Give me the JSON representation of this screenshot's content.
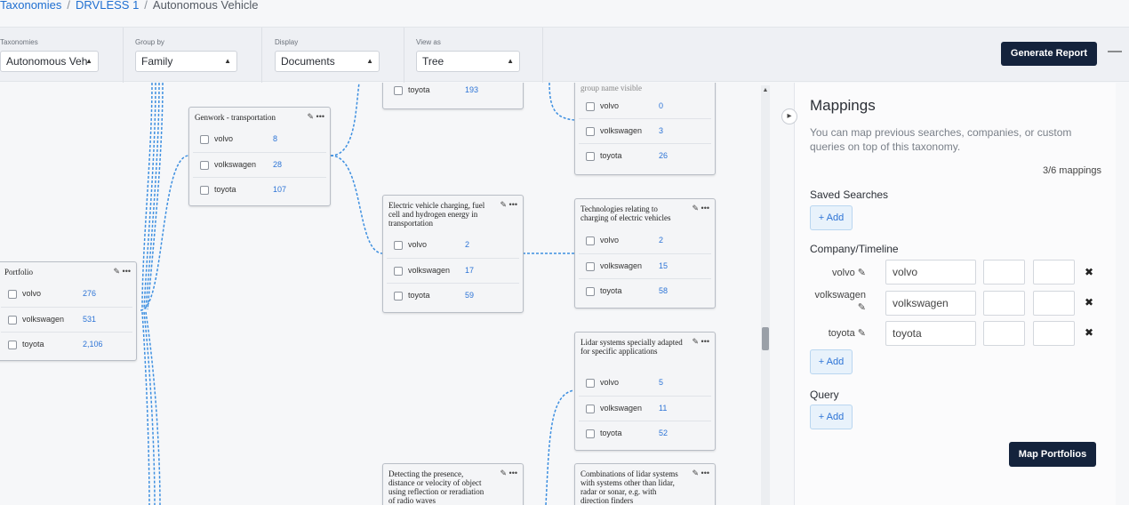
{
  "breadcrumb": {
    "items": [
      "Taxonomies",
      "DRVLESS 1",
      "Autonomous Vehicle"
    ],
    "separator": "/"
  },
  "toolbar": {
    "groups": [
      {
        "label": "Taxonomies",
        "value": "Autonomous Veh"
      },
      {
        "label": "Group by",
        "value": "Family"
      },
      {
        "label": "Display",
        "value": "Documents"
      },
      {
        "label": "View as",
        "value": "Tree"
      }
    ],
    "generate_report": "Generate Report",
    "more_icon": "more-horizontal-icon"
  },
  "tree": {
    "nodes": [
      {
        "id": "portfolio",
        "title": "Portfolio",
        "rows": [
          {
            "label": "volvo",
            "count": "276"
          },
          {
            "label": "volkswagen",
            "count": "531"
          },
          {
            "label": "toyota",
            "count": "2,106"
          }
        ]
      },
      {
        "id": "genwork",
        "title": "Genwork - transportation",
        "rows": [
          {
            "label": "volvo",
            "count": "8"
          },
          {
            "label": "volkswagen",
            "count": "28"
          },
          {
            "label": "toyota",
            "count": "107"
          }
        ]
      },
      {
        "id": "top-mid",
        "title": "",
        "rows": [
          {
            "label": "toyota",
            "count": "193"
          }
        ]
      },
      {
        "id": "ev",
        "title": "Electric vehicle charging, fuel cell and hydrogen energy in transportation",
        "rows": [
          {
            "label": "volvo",
            "count": "2"
          },
          {
            "label": "volkswagen",
            "count": "17"
          },
          {
            "label": "toyota",
            "count": "59"
          }
        ]
      },
      {
        "id": "top-right",
        "title": "group name visible",
        "rows": [
          {
            "label": "volvo",
            "count": "0"
          },
          {
            "label": "volkswagen",
            "count": "3"
          },
          {
            "label": "toyota",
            "count": "26"
          }
        ]
      },
      {
        "id": "tech",
        "title": "Technologies relating to charging of electric vehicles",
        "rows": [
          {
            "label": "volvo",
            "count": "2"
          },
          {
            "label": "volkswagen",
            "count": "15"
          },
          {
            "label": "toyota",
            "count": "58"
          }
        ]
      },
      {
        "id": "lidar",
        "title": "Lidar systems specially adapted for specific applications",
        "rows": [
          {
            "label": "volvo",
            "count": "5"
          },
          {
            "label": "volkswagen",
            "count": "11"
          },
          {
            "label": "toyota",
            "count": "52"
          }
        ]
      },
      {
        "id": "detect",
        "title": "Detecting the presence, distance or velocity of object using reflection or reradiation of radio waves",
        "rows": []
      },
      {
        "id": "combo",
        "title": "Combinations of lidar systems with systems other than lidar, radar or sonar, e.g. with direction finders",
        "rows": []
      }
    ]
  },
  "panel": {
    "title": "Mappings",
    "description": "You can map previous searches, companies, or custom queries on top of this taxonomy.",
    "count": "3/6 mappings",
    "saved_searches": {
      "heading": "Saved Searches",
      "add": "+ Add"
    },
    "company_timeline": {
      "heading": "Company/Timeline",
      "add": "+ Add",
      "rows": [
        {
          "label": "volvo",
          "value": "volvo"
        },
        {
          "label": "volkswagen",
          "value": "volkswagen"
        },
        {
          "label": "toyota",
          "value": "toyota"
        }
      ]
    },
    "query": {
      "heading": "Query",
      "add": "+ Add"
    },
    "map_button": "Map Portfolios"
  },
  "colors": {
    "link": "#1f6fd1",
    "primary_button": "#14233c",
    "count": "#2d74d6",
    "edge": "#3d8fe0"
  }
}
